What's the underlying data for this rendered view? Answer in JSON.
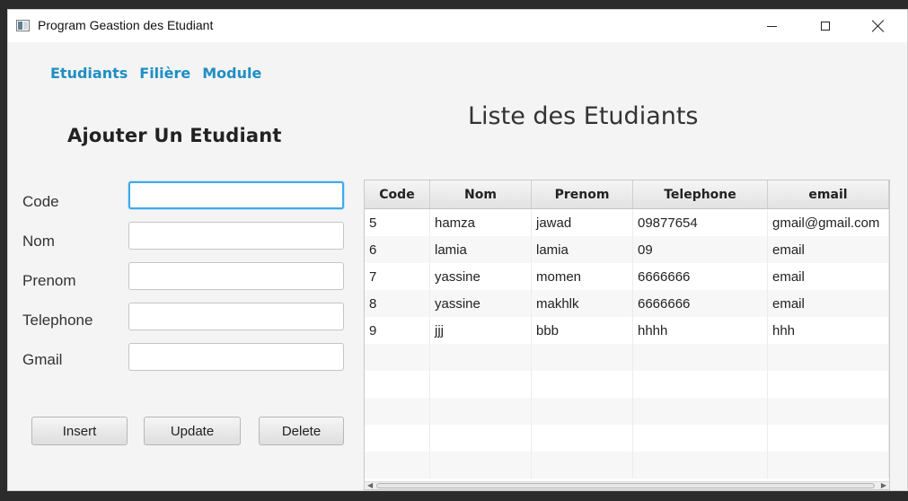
{
  "window": {
    "title": "Program Geastion des Etudiant"
  },
  "menu": {
    "items": [
      "Etudiants",
      "Filière",
      "Module"
    ]
  },
  "form": {
    "title": "Ajouter Un Etudiant",
    "fields": [
      {
        "label": "Code",
        "value": "",
        "placeholder": ""
      },
      {
        "label": "Nom",
        "value": "",
        "placeholder": ""
      },
      {
        "label": "Prenom",
        "value": "",
        "placeholder": ""
      },
      {
        "label": "Telephone",
        "value": "",
        "placeholder": ""
      },
      {
        "label": "Gmail",
        "value": "",
        "placeholder": ""
      }
    ],
    "buttons": {
      "insert": "Insert",
      "update": "Update",
      "delete": "Delete"
    }
  },
  "list": {
    "title": "Liste des Etudiants",
    "columns": [
      "Code",
      "Nom",
      "Prenom",
      "Telephone",
      "email"
    ],
    "rows": [
      [
        "5",
        "hamza",
        "jawad",
        "09877654",
        "gmail@gmail.com"
      ],
      [
        "6",
        "lamia",
        "lamia",
        "09",
        "email"
      ],
      [
        "7",
        "yassine",
        "momen",
        "6666666",
        "email"
      ],
      [
        "8",
        "yassine",
        "makhlk",
        "6666666",
        "email"
      ],
      [
        "9",
        "jjj",
        "bbb",
        "hhhh",
        "hhh"
      ]
    ],
    "empty_rows": 5
  },
  "colors": {
    "menu_accent": "#1e8ec4",
    "focus_ring": "#3fa9e8"
  },
  "icons": {
    "app": "app-window-icon",
    "minimize": "minimize-icon",
    "maximize": "maximize-icon",
    "close": "close-icon"
  }
}
